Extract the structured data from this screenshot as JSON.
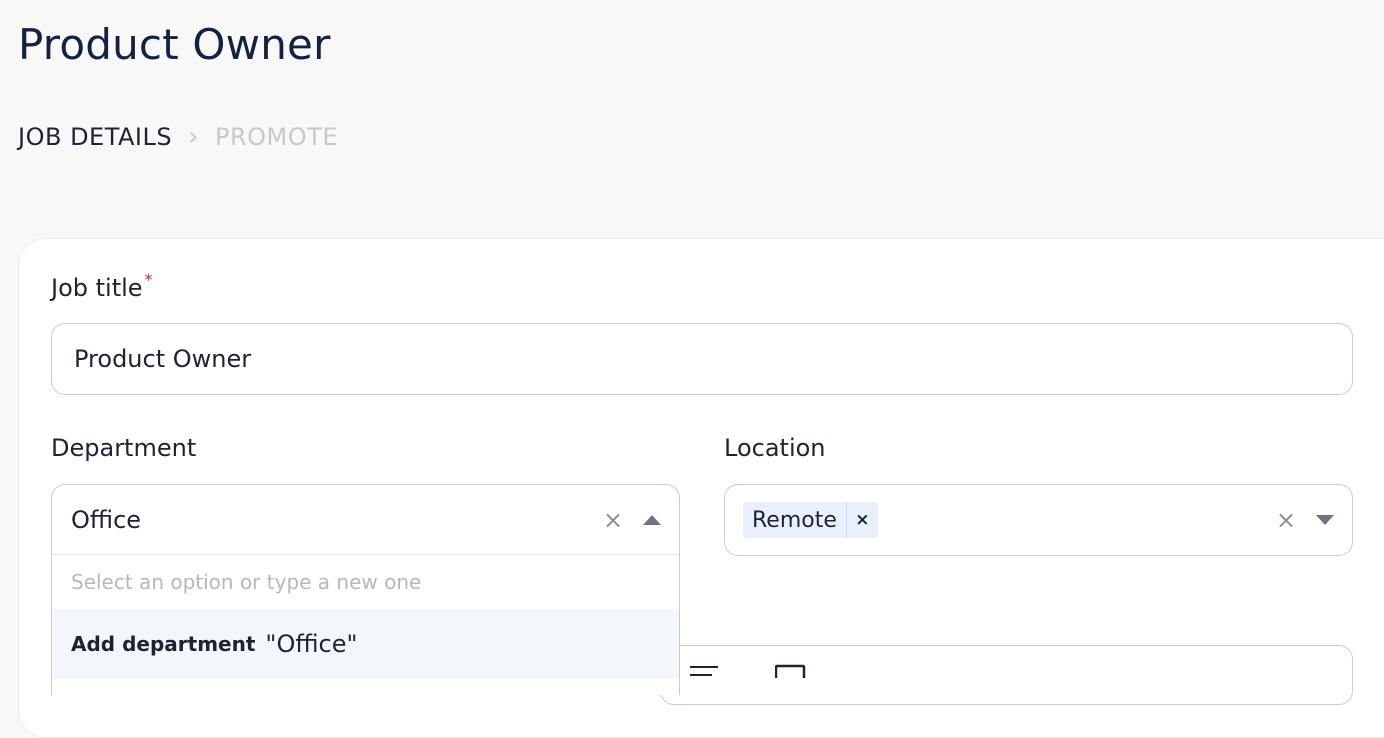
{
  "page": {
    "title": "Product Owner"
  },
  "stepper": {
    "steps": [
      {
        "label": "JOB DETAILS",
        "state": "active"
      },
      {
        "label": "PROMOTE",
        "state": "inactive"
      }
    ]
  },
  "form": {
    "job_title": {
      "label": "Job title",
      "required_mark": "*",
      "value": "Product Owner"
    },
    "department": {
      "label": "Department",
      "value": "Office",
      "clear_icon": "close-icon",
      "toggle_icon": "caret-up-icon",
      "dropdown": {
        "placeholder": "Select an option or type a new one",
        "create_option_prefix": "Add department",
        "create_option_value": "\"Office\""
      }
    },
    "location": {
      "label": "Location",
      "tags": [
        "Remote"
      ],
      "tag_remove": "×",
      "clear_icon": "close-icon",
      "toggle_icon": "caret-down-icon"
    },
    "description_toolbar": {
      "icons": [
        "align-icon",
        "image-icon"
      ]
    }
  },
  "colors": {
    "title": "#0f2344",
    "required": "#e02424",
    "background": "#f9f8f7",
    "highlight_option": "#f3f6fb",
    "tag_background": "#e8f1fb"
  }
}
